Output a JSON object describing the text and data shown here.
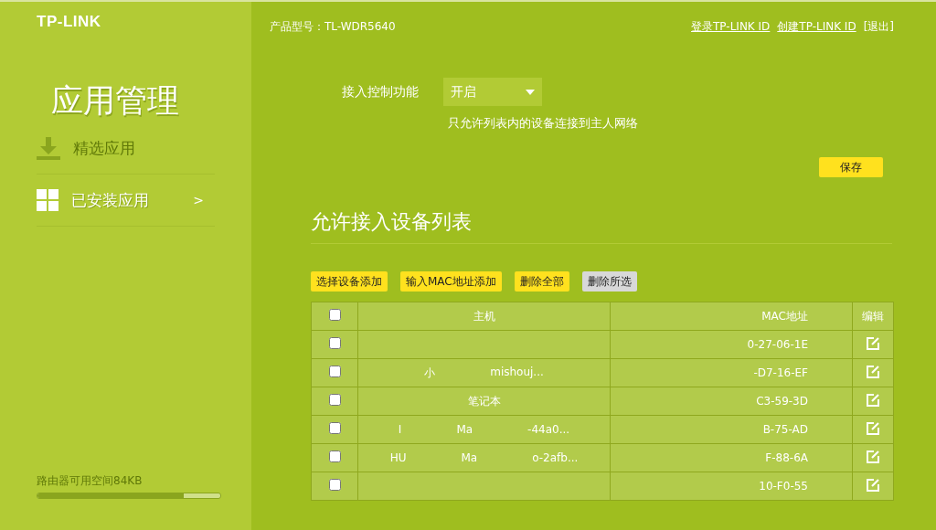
{
  "sidebar": {
    "logo": "TP-LINK",
    "title": "应用管理",
    "items": [
      {
        "kind": "download",
        "label": "精选应用",
        "selected": false
      },
      {
        "kind": "grid",
        "label": "已安装应用",
        "selected": true,
        "arrow": ">"
      }
    ],
    "storage": {
      "label": "路由器可用空间84KB",
      "level": 0.8
    }
  },
  "header": {
    "model": "产品型号：TL-WDR5640",
    "links": [
      "登录TP-LINK ID",
      "创建TP-LINK ID"
    ],
    "logout": "[退出]"
  },
  "access_control": {
    "label": "接入控制功能",
    "value": "开启",
    "hint": "只允许列表内的设备连接到主人网络",
    "save": "保存"
  },
  "section_title": "允许接入设备列表",
  "actions": [
    {
      "label": "选择设备添加",
      "disabled": false
    },
    {
      "label": "输入MAC地址添加",
      "disabled": false
    },
    {
      "label": "删除全部",
      "disabled": false
    },
    {
      "label": "删除所选",
      "disabled": true
    }
  ],
  "table": {
    "columns": [
      "主机",
      "MAC地址",
      "编辑"
    ],
    "header_checked": false,
    "rows": [
      {
        "checked": false,
        "host": [],
        "mac": "0-27-06-1E"
      },
      {
        "checked": false,
        "host": [
          "小",
          "mishouj..."
        ],
        "mac": "-D7-16-EF"
      },
      {
        "checked": false,
        "host": [
          "笔记本"
        ],
        "mac": "C3-59-3D"
      },
      {
        "checked": false,
        "host": [
          "I",
          "Ma",
          "-44a0..."
        ],
        "mac": "B-75-AD"
      },
      {
        "checked": false,
        "host": [
          "HU",
          "Ma",
          "o-2afb..."
        ],
        "mac": "F-88-6A"
      },
      {
        "checked": false,
        "host": [],
        "mac": "10-F0-55"
      }
    ]
  }
}
